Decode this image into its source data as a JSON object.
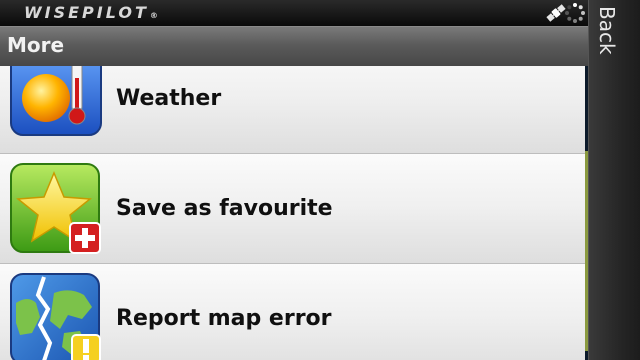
{
  "status": {
    "brand": "WISEPILOT",
    "brand_mark": "®",
    "icons": [
      "satellite-icon",
      "gps-searching-icon"
    ]
  },
  "header": {
    "title": "More"
  },
  "softkeys": {
    "back_label": "Back"
  },
  "menu": {
    "items": [
      {
        "label": "Weather",
        "icon": "weather-icon"
      },
      {
        "label": "Save as favourite",
        "icon": "favourite-add-icon"
      },
      {
        "label": "Report map error",
        "icon": "map-error-icon"
      }
    ]
  },
  "colors": {
    "title_bar": "#5b5b5b",
    "status_bar": "#0a0a0a",
    "list_bg": "#f0f0f0",
    "scroll_thumb": "#8a9a40"
  }
}
